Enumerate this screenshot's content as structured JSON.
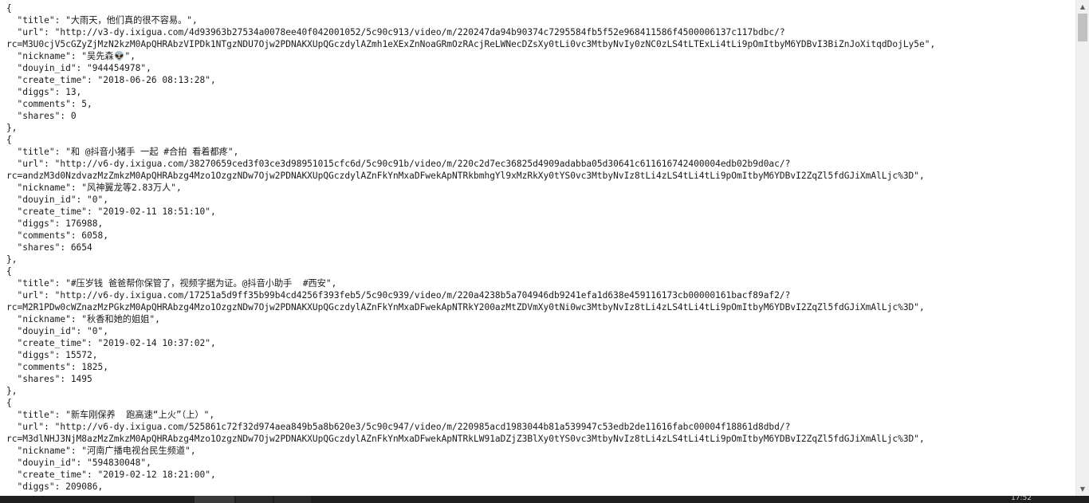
{
  "document": {
    "lines": [
      "{",
      "  \"title\": \"大雨天，他们真的很不容易。\",",
      "  \"url\": \"http://v3-dy.ixigua.com/4d93963b27534a0078ee40f042001052/5c90c913/video/m/220247da94b90374c7295584fb5f52e968411586f4500006137c117bdbc/?",
      "rc=M3U0cjV5cGZyZjMzN2kzM0ApQHRAbzVIPDk1NTgzNDU7Ojw2PDNAKXUpQGczdylAZmh1eXExZnNoaGRmOzRAcjReLWNecDZsXy0tLi0vc3MtbyNvIy0zNC0zLS4tLTExLi4tLi9pOmItbyM6YDBvI3BiZnJoXitqdDojLy5e\",",
      "  \"nickname\": \"吴先森👽\",",
      "  \"douyin_id\": \"944454978\",",
      "  \"create_time\": \"2018-06-26 08:13:28\",",
      "  \"diggs\": 13,",
      "  \"comments\": 5,",
      "  \"shares\": 0",
      "},",
      "{",
      "  \"title\": \"和 @抖音小猪手 一起 #合拍 看着都疼\",",
      "  \"url\": \"http://v6-dy.ixigua.com/38270659ced3f03ce3d98951015cfc6d/5c90c91b/video/m/220c2d7ec36825d4909adabba05d30641c611616742400004edb02b9d0ac/?",
      "rc=andzM3d0NzdvazMzZmkzM0ApQHRAbzg4Mzo1OzgzNDw7Ojw2PDNAKXUpQGczdylAZnFkYnMxaDFwekApNTRkbmhgYl9xMzRkXy0tYS0vc3MtbyNvIz8tLi4zLS4tLi4tLi9pOmItbyM6YDBvI2ZqZl5fdGJiXmAlLjc%3D\",",
      "  \"nickname\": \"风神翼龙等2.83万人\",",
      "  \"douyin_id\": \"0\",",
      "  \"create_time\": \"2019-02-11 18:51:10\",",
      "  \"diggs\": 176988,",
      "  \"comments\": 6058,",
      "  \"shares\": 6654",
      "},",
      "{",
      "  \"title\": \"#压岁钱 爸爸帮你保管了，视频字据为证。@抖音小助手  #西安\",",
      "  \"url\": \"http://v6-dy.ixigua.com/17251a5d9ff35b99b4cd4256f393feb5/5c90c939/video/m/220a4238b5a704946db9241efa1d638e459116173cb00000161bacf89af2/?",
      "rc=M2R1PDw0cWZnazMzPGkzM0ApQHRAbzg4Mzo1OzgzNDw7Ojw2PDNAKXUpQGczdylAZnFkYnMxaDFwekApNTRkY200azMtZDVmXy0tNi0wc3MtbyNvIz8tLi4zLS4tLi4tLi9pOmItbyM6YDBvI2ZqZl5fdGJiXmAlLjc%3D\",",
      "  \"nickname\": \"秋香和她的姐姐\",",
      "  \"douyin_id\": \"0\",",
      "  \"create_time\": \"2019-02-14 10:37:02\",",
      "  \"diggs\": 15572,",
      "  \"comments\": 1825,",
      "  \"shares\": 1495",
      "},",
      "{",
      "  \"title\": \"新车刚保养  跑高速“上火”（上）\",",
      "  \"url\": \"http://v6-dy.ixigua.com/525861c72f32d974aea849b5a8b620e3/5c90c947/video/m/220985acd1983044b81a539947c53edb2de11616fabc00004f18861d8dbd/?",
      "rc=M3dlNHJ3NjM8azMzZmkzM0ApQHRAbzg4Mzo1OzgzNDw7Ojw2PDNAKXUpQGczdylAZnFkYnMxaDFwekApNTRkLW91aDZjZ3BlXy0tYS0vc3MtbyNvIz8tLi4zLS4tLi4tLi9pOmItbyM6YDBvI2ZqZl5fdGJiXmAlLjc%3D\",",
      "  \"nickname\": \"河南广播电视台民生频道\",",
      "  \"douyin_id\": \"594830048\",",
      "  \"create_time\": \"2019-02-12 18:21:00\",",
      "  \"diggs\": 209086,"
    ]
  },
  "scrollbar": {
    "up_arrow": "▲",
    "down_arrow": "▼"
  },
  "taskbar": {
    "clock": "17:52"
  },
  "colors": {
    "text": "#1a1a1a",
    "background": "#ffffff",
    "scroll_track": "#f0f0f0",
    "scroll_thumb": "#c1c1c1",
    "taskbar": "#1f1f1f"
  }
}
